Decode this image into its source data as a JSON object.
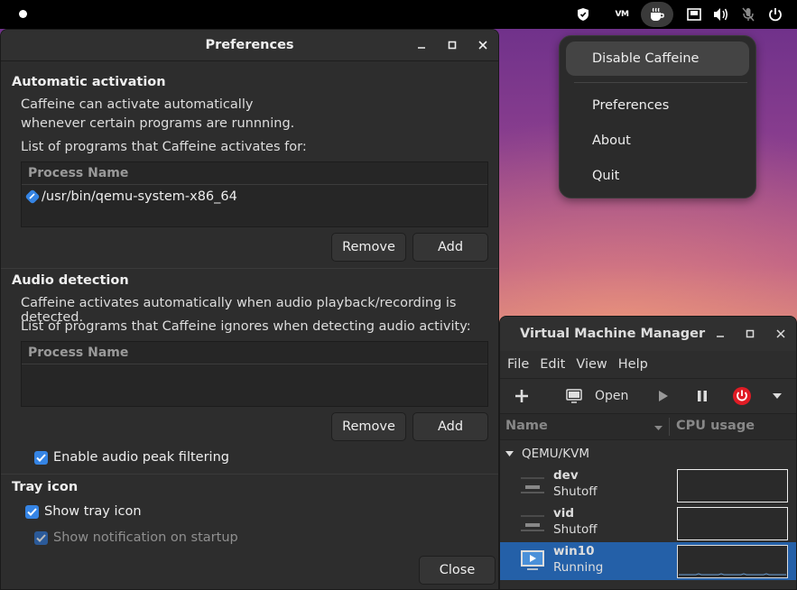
{
  "topbar": {
    "tray": [
      {
        "icon": "shield-icon"
      },
      {
        "icon": "vm-icon",
        "text": "VM"
      },
      {
        "icon": "coffee-cup-icon"
      },
      {
        "icon": "network-wired-icon"
      },
      {
        "icon": "speaker-icon"
      },
      {
        "icon": "microphone-muted-icon"
      },
      {
        "icon": "power-icon"
      }
    ]
  },
  "caffeine_menu": {
    "items": [
      "Disable Caffeine",
      "Preferences",
      "About",
      "Quit"
    ]
  },
  "preferences": {
    "title": "Preferences",
    "auto": {
      "heading": "Automatic activation",
      "desc_line1": "Caffeine can activate automatically",
      "desc_line2": "whenever certain programs are runnning.",
      "list_label": "List of programs that Caffeine activates for:",
      "column": "Process Name",
      "rows": [
        "/usr/bin/qemu-system-x86_64"
      ],
      "remove": "Remove",
      "add": "Add"
    },
    "audio": {
      "heading": "Audio detection",
      "desc": "Caffeine activates automatically when audio playback/recording is detected.",
      "list_label": "List of programs that Caffeine ignores when detecting audio activity:",
      "column": "Process Name",
      "remove": "Remove",
      "add": "Add",
      "peak_filter": "Enable audio peak filtering"
    },
    "tray": {
      "heading": "Tray icon",
      "show_icon": "Show tray icon",
      "show_notification": "Show notification on startup"
    },
    "close": "Close"
  },
  "vmm": {
    "title": "Virtual Machine Manager",
    "menus": [
      "File",
      "Edit",
      "View",
      "Help"
    ],
    "toolbar": {
      "open": "Open"
    },
    "columns": {
      "name": "Name",
      "cpu": "CPU usage"
    },
    "group": "QEMU/KVM",
    "vms": [
      {
        "name": "dev",
        "state": "Shutoff"
      },
      {
        "name": "vid",
        "state": "Shutoff"
      },
      {
        "name": "win10",
        "state": "Running"
      }
    ]
  },
  "colors": {
    "accent": "#3584e4",
    "selection": "#2460a8",
    "power_red": "#e01b24"
  }
}
